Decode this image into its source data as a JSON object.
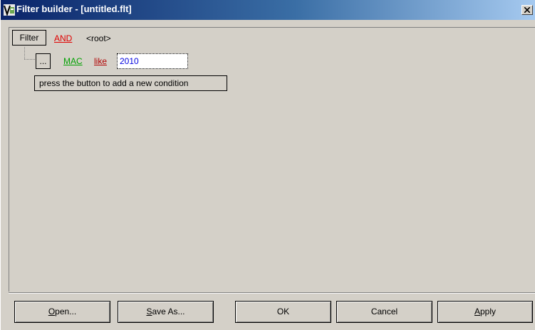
{
  "window": {
    "title": "Filter builder - [untitled.flt]",
    "close_label": "×"
  },
  "filter": {
    "root_button": "Filter",
    "operator": "AND",
    "root_label": "<root>",
    "condition": {
      "menu_button": "...",
      "field": "MAC",
      "comparison": "like",
      "value": "2010"
    },
    "hint": "press the button to add a new condition"
  },
  "buttons": {
    "open": {
      "label": "Open...",
      "mnemonic": "O",
      "rest": "pen..."
    },
    "save_as": {
      "label": "Save As...",
      "mnemonic": "S",
      "rest": "ave As..."
    },
    "ok": {
      "label": "OK"
    },
    "cancel": {
      "label": "Cancel"
    },
    "apply": {
      "label": "Apply",
      "mnemonic": "A",
      "rest": "pply"
    }
  },
  "colors": {
    "operator": "#e00000",
    "field": "#00a000",
    "comparison": "#b00000",
    "value": "#0000e0",
    "title_gradient_start": "#0a246a",
    "title_gradient_end": "#a6caf0"
  }
}
